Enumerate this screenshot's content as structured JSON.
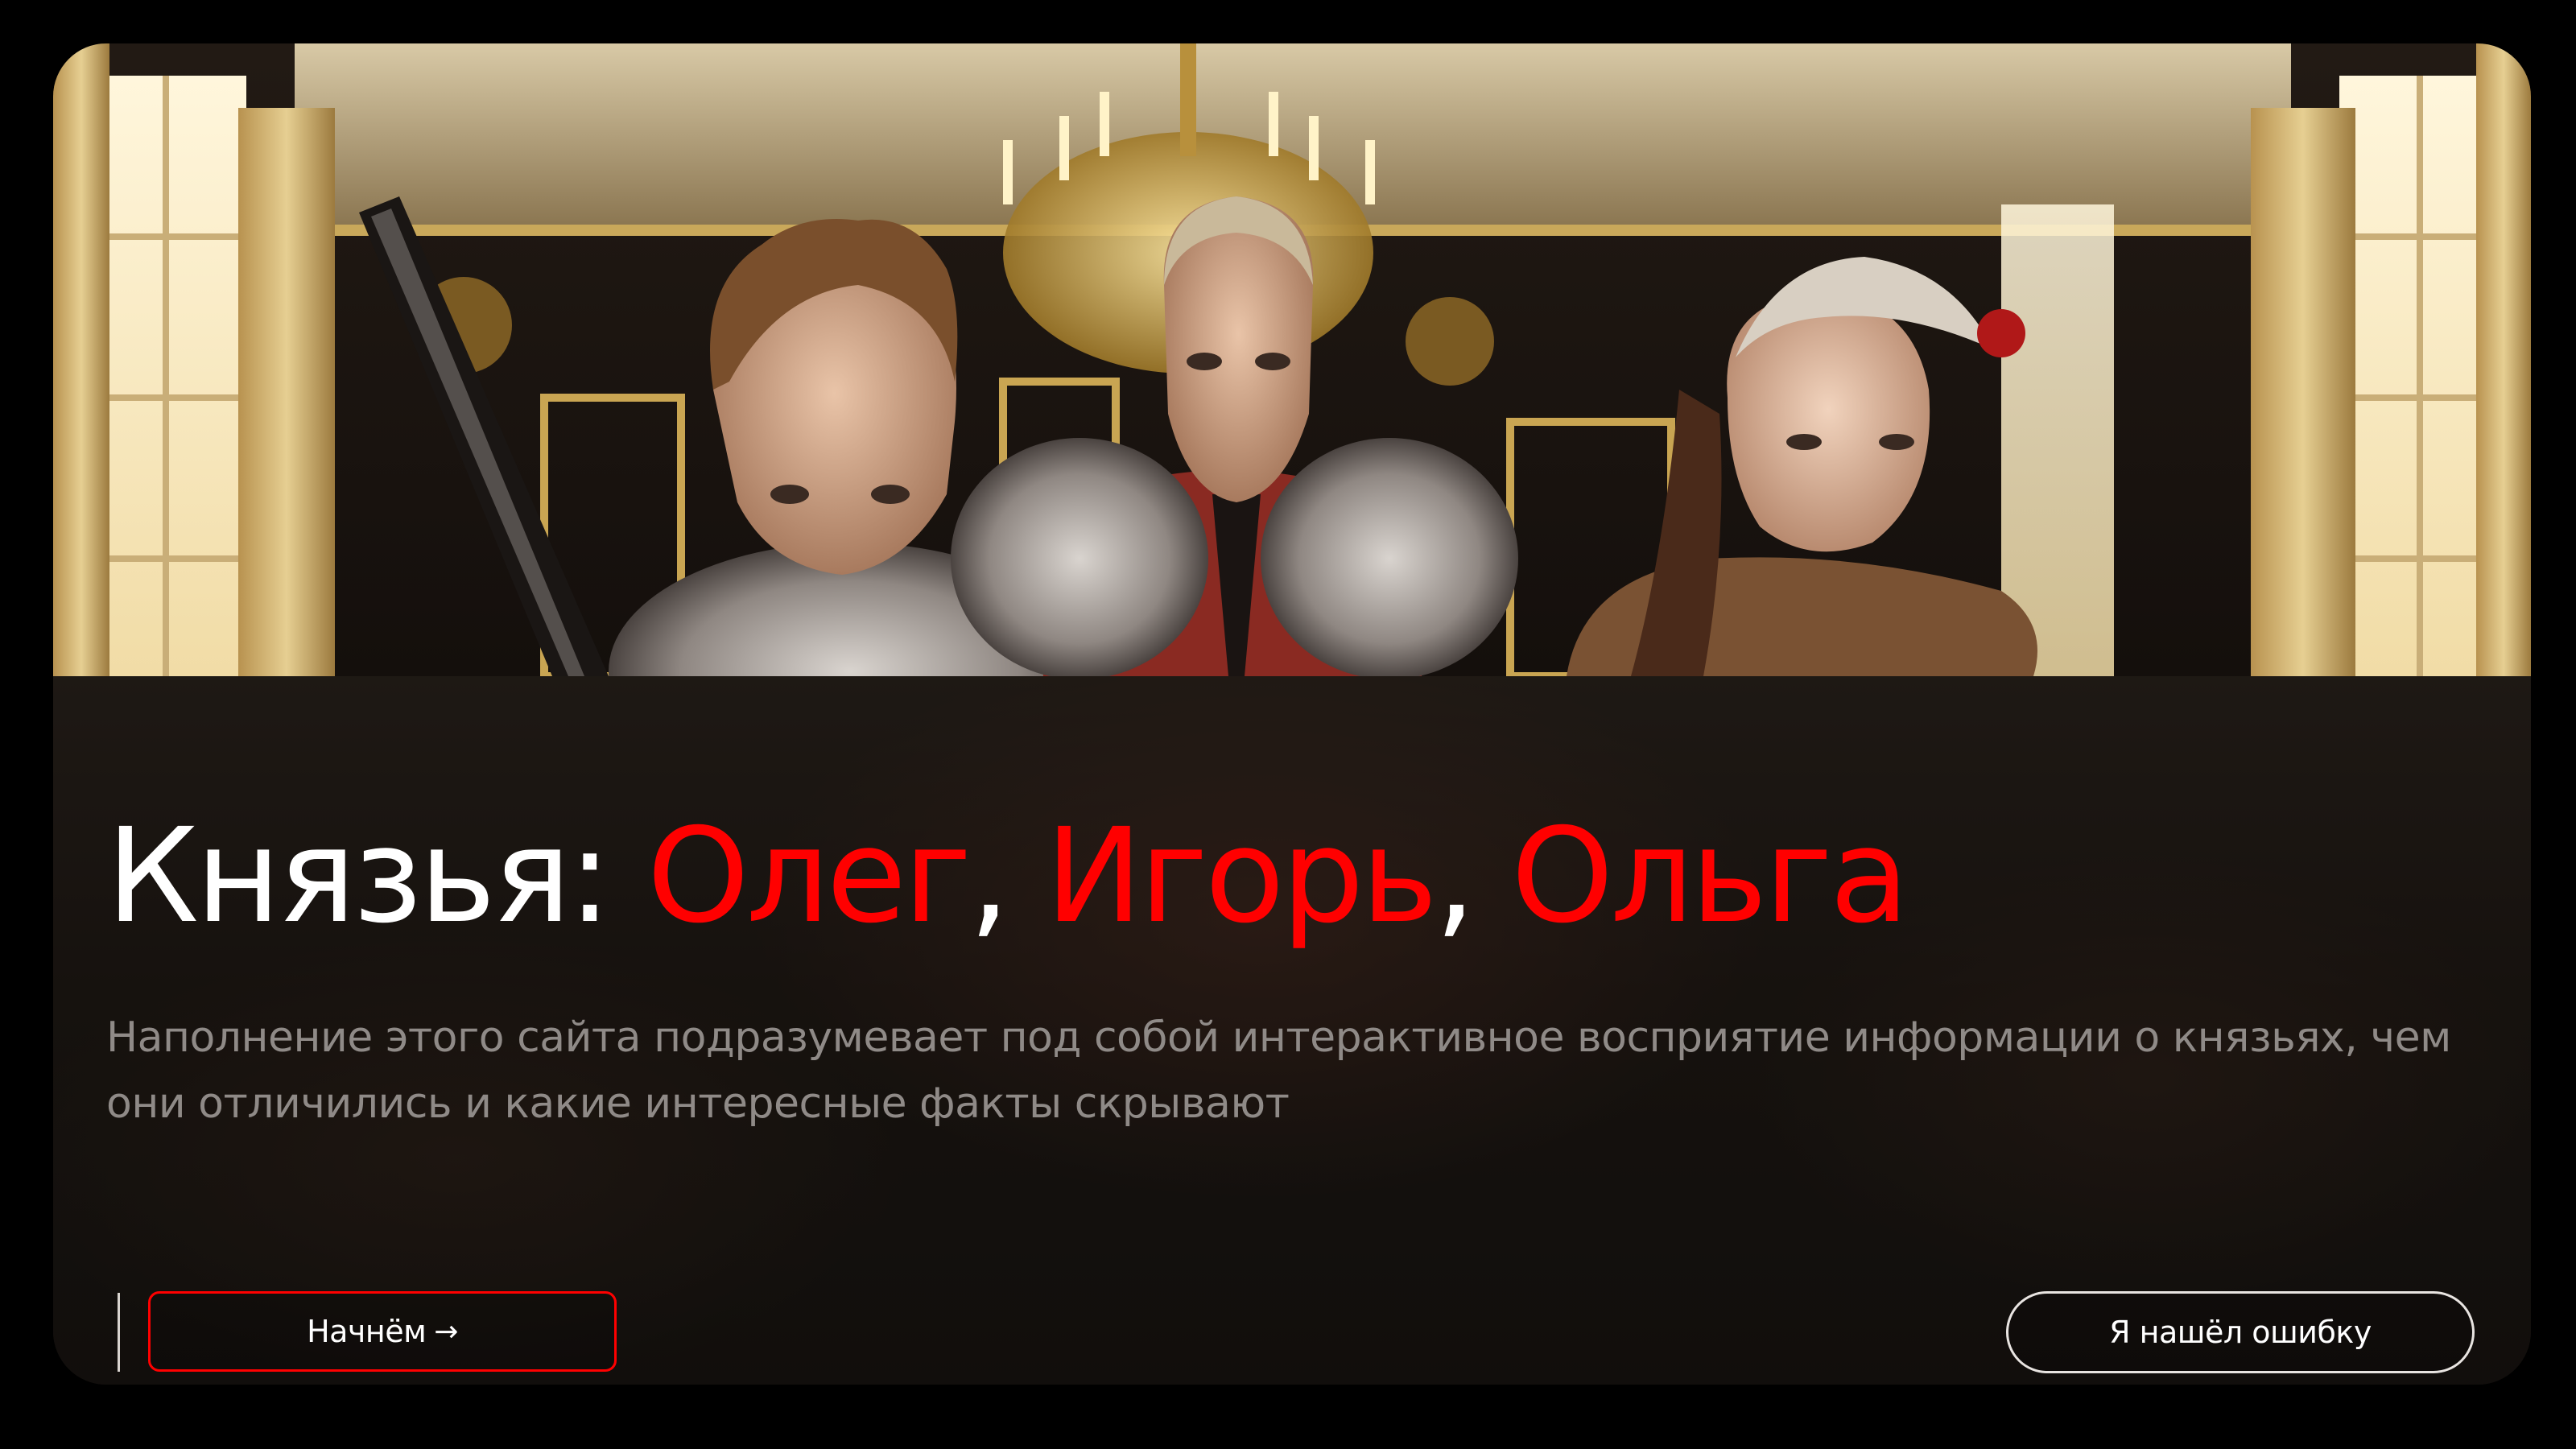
{
  "hero": {
    "title_prefix": "Князья: ",
    "name_oleg": "Олег",
    "sep_1": ", ",
    "name_igor": "Игорь",
    "sep_2": ", ",
    "name_olga": "Ольга",
    "description": "Наполнение этого сайта подразумевает под собой интерактивное восприятие информации о князьях, чем они отличились и какие интересные факты скрывают"
  },
  "actions": {
    "start_label": "Начнём",
    "start_icon": "arrow-right-icon",
    "report_label": "Я нашёл ошибку"
  },
  "colors": {
    "accent": "#ff0000",
    "background": "#000000",
    "text_primary": "#ffffff",
    "text_secondary": "#8f8a87"
  }
}
